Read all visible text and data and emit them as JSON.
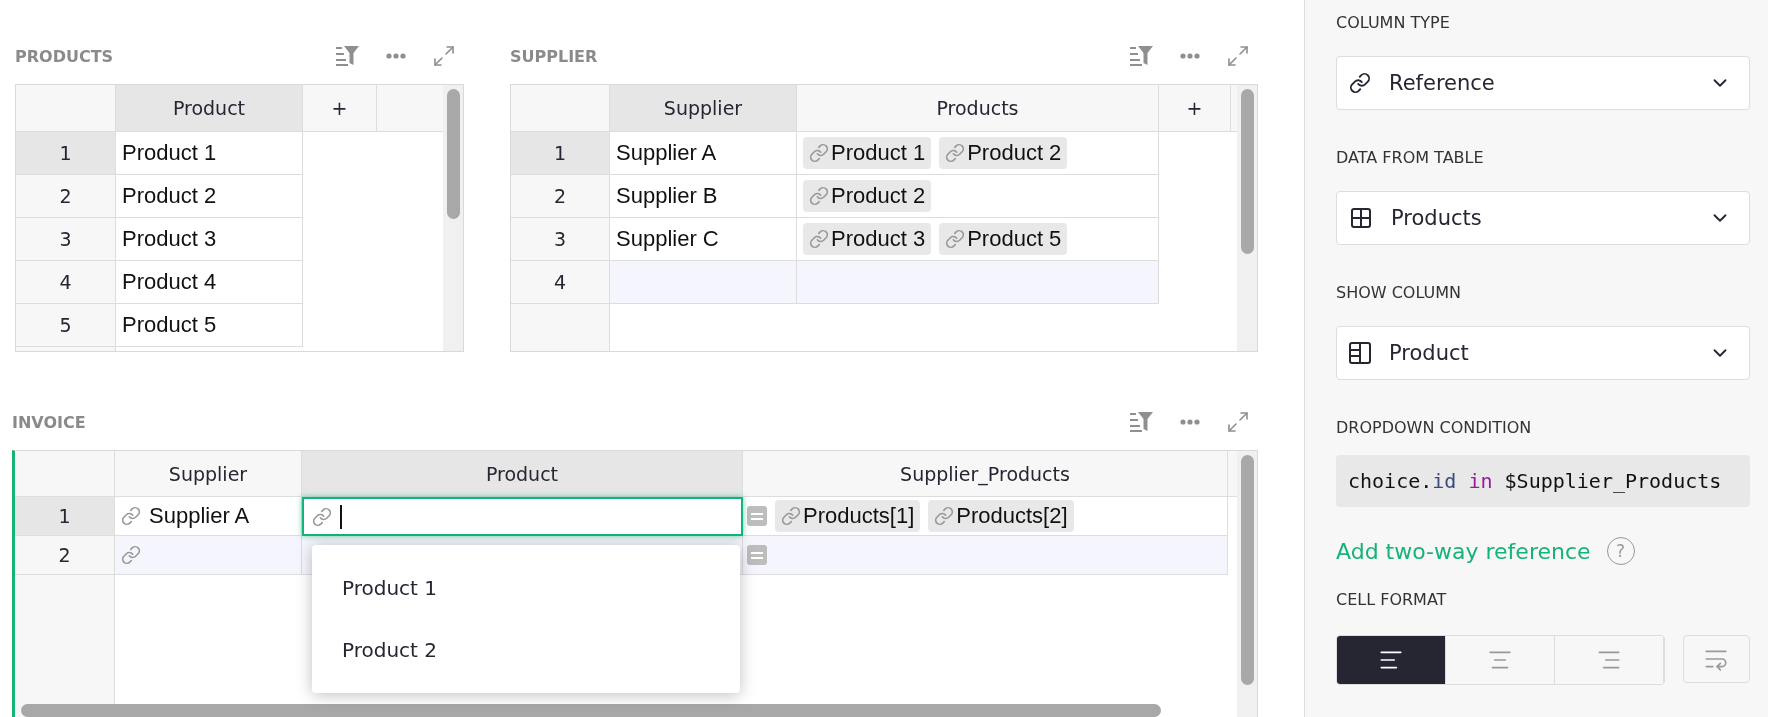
{
  "tables": [
    {
      "title": "PRODUCTS",
      "active": false,
      "columns": [
        {
          "label": "Product",
          "selected": true
        }
      ],
      "add_column": "+",
      "rows": [
        {
          "number": "1",
          "selected": true,
          "kind": "data",
          "cells": [
            {
              "kind": "text",
              "text": "Product 1"
            }
          ]
        },
        {
          "number": "2",
          "selected": false,
          "kind": "data",
          "cells": [
            {
              "kind": "text",
              "text": "Product 2"
            }
          ]
        },
        {
          "number": "3",
          "selected": false,
          "kind": "data",
          "cells": [
            {
              "kind": "text",
              "text": "Product 3"
            }
          ]
        },
        {
          "number": "4",
          "selected": false,
          "kind": "data",
          "cells": [
            {
              "kind": "text",
              "text": "Product 4"
            }
          ]
        },
        {
          "number": "5",
          "selected": false,
          "kind": "data",
          "cells": [
            {
              "kind": "text",
              "text": "Product 5"
            }
          ]
        }
      ]
    },
    {
      "title": "SUPPLIER",
      "active": false,
      "columns": [
        {
          "label": "Supplier",
          "selected": true
        },
        {
          "label": "Products",
          "selected": false
        }
      ],
      "add_column": "+",
      "rows": [
        {
          "number": "1",
          "selected": true,
          "kind": "data",
          "cells": [
            {
              "kind": "text",
              "text": "Supplier A"
            },
            {
              "kind": "ref_list",
              "items": [
                "Product 1",
                "Product 2"
              ]
            }
          ]
        },
        {
          "number": "2",
          "selected": false,
          "kind": "data",
          "cells": [
            {
              "kind": "text",
              "text": "Supplier B"
            },
            {
              "kind": "ref_list",
              "items": [
                "Product 2"
              ]
            }
          ]
        },
        {
          "number": "3",
          "selected": false,
          "kind": "data",
          "cells": [
            {
              "kind": "text",
              "text": "Supplier C"
            },
            {
              "kind": "ref_list",
              "items": [
                "Product 3",
                "Product 5"
              ]
            }
          ]
        },
        {
          "number": "4",
          "selected": false,
          "kind": "new",
          "cells": [
            {
              "kind": "empty"
            },
            {
              "kind": "empty"
            }
          ]
        }
      ]
    },
    {
      "title": "INVOICE",
      "active": true,
      "columns": [
        {
          "label": "Supplier",
          "selected": false
        },
        {
          "label": "Product",
          "selected": true
        },
        {
          "label": "Supplier_Products",
          "selected": false
        }
      ],
      "rows": [
        {
          "number": "1",
          "selected": true,
          "kind": "data",
          "cells": [
            {
              "kind": "ref",
              "text": "Supplier A"
            },
            {
              "kind": "editor"
            },
            {
              "kind": "formula",
              "items": [
                "Products[1]",
                "Products[2]"
              ]
            }
          ]
        },
        {
          "number": "2",
          "selected": false,
          "kind": "new",
          "cells": [
            {
              "kind": "ref"
            },
            {
              "kind": "empty"
            },
            {
              "kind": "formula"
            }
          ]
        }
      ],
      "dropdown": {
        "options": [
          "Product 1",
          "Product 2"
        ]
      }
    }
  ],
  "panel": {
    "fields": [
      {
        "label": "COLUMN TYPE",
        "kind": "select",
        "value": "Reference"
      },
      {
        "label": "DATA FROM TABLE",
        "kind": "select",
        "value": "Products"
      },
      {
        "label": "SHOW COLUMN",
        "kind": "select",
        "value": "Product"
      },
      {
        "label": "DROPDOWN CONDITION",
        "kind": "code",
        "tokens": [
          {
            "text": "choice.",
            "kind": "plain"
          },
          {
            "text": "id",
            "kind": "attr"
          },
          {
            "text": " in",
            "kind": "keyword"
          },
          {
            "text": " $Supplier_Products",
            "kind": "plain"
          }
        ]
      }
    ],
    "link": "Add two-way reference",
    "help": "?",
    "cell_format": {
      "label": "CELL FORMAT",
      "alignment": [
        {
          "selected": true
        },
        {
          "selected": false
        },
        {
          "selected": false
        }
      ],
      "wrap": {
        "on": false
      }
    }
  }
}
